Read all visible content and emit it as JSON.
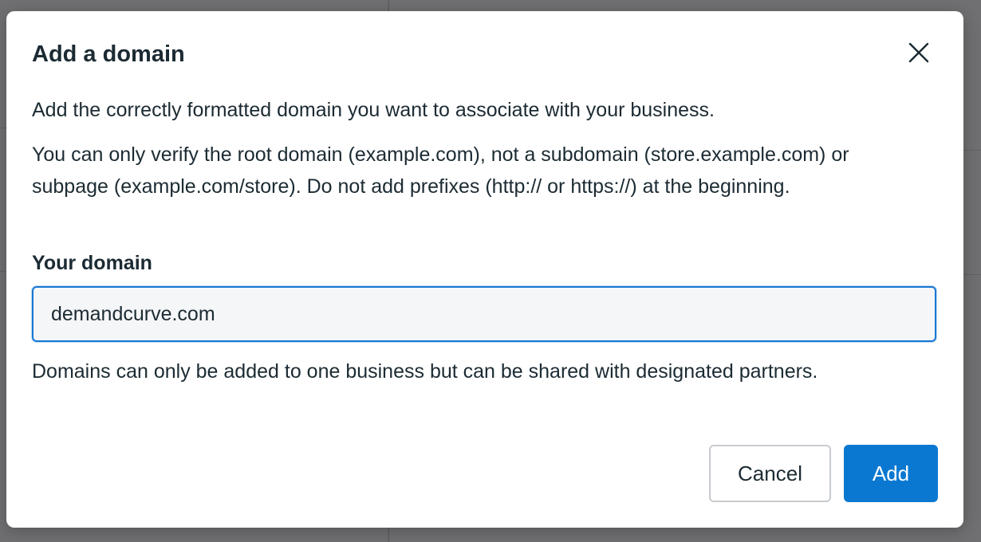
{
  "dialog": {
    "title": "Add a domain",
    "description": "Add the correctly formatted domain you want to associate with your business.",
    "root_domain_note": "You can only verify the root domain (example.com), not a subdomain (store.example.com) or subpage (example.com/store). Do not add prefixes (http:// or https://) at the beginning.",
    "field_label": "Your domain",
    "domain_value": "demandcurve.com",
    "sharing_note": "Domains can only be added to one business but can be shared with designated partners.",
    "cancel_label": "Cancel",
    "add_label": "Add",
    "close_icon": "close-icon"
  },
  "colors": {
    "primary_button": "#0a78d1",
    "input_focus_border": "#1877d4",
    "text": "#1c2b33",
    "overlay": "#707072"
  }
}
